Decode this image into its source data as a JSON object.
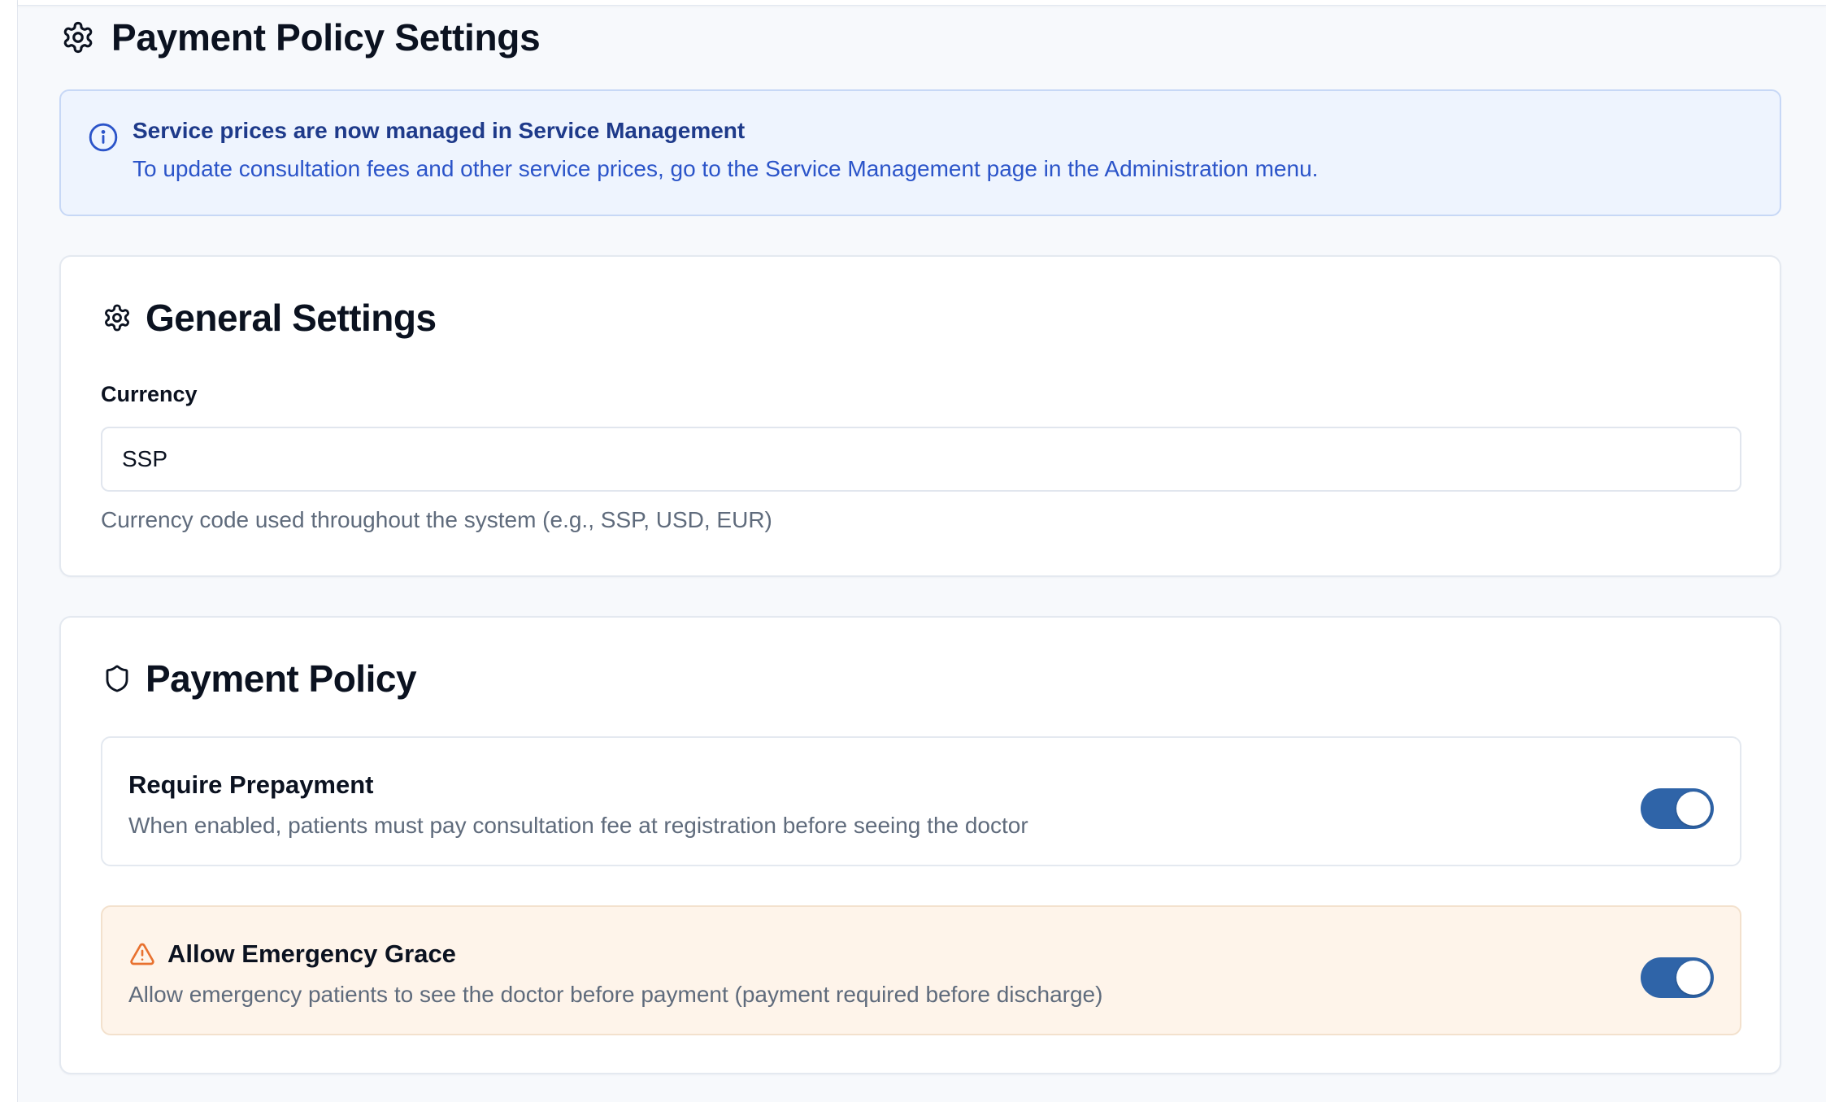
{
  "page": {
    "title": "Payment Policy Settings",
    "title_icon": "gear-icon"
  },
  "info_banner": {
    "icon": "info-icon",
    "title": "Service prices are now managed in Service Management",
    "body": "To update consultation fees and other service prices, go to the Service Management page in the Administration menu."
  },
  "general_settings": {
    "icon": "gear-icon",
    "title": "General Settings",
    "currency": {
      "label": "Currency",
      "value": "SSP",
      "help": "Currency code used throughout the system (e.g., SSP, USD, EUR)"
    }
  },
  "payment_policy": {
    "icon": "shield-icon",
    "title": "Payment Policy",
    "settings": [
      {
        "title": "Require Prepayment",
        "description": "When enabled, patients must pay consultation fee at registration before seeing the doctor",
        "enabled": true
      },
      {
        "icon": "warning-icon",
        "title": "Allow Emergency Grace",
        "description": "Allow emergency patients to see the doctor before payment (payment required before discharge)",
        "enabled": true
      }
    ]
  },
  "colors": {
    "accent": "#2f64a8",
    "info_background": "#eef4fe",
    "info_text": "#2b54c9",
    "warning_background": "#fef4ea",
    "warning_icon": "#e8712f"
  }
}
